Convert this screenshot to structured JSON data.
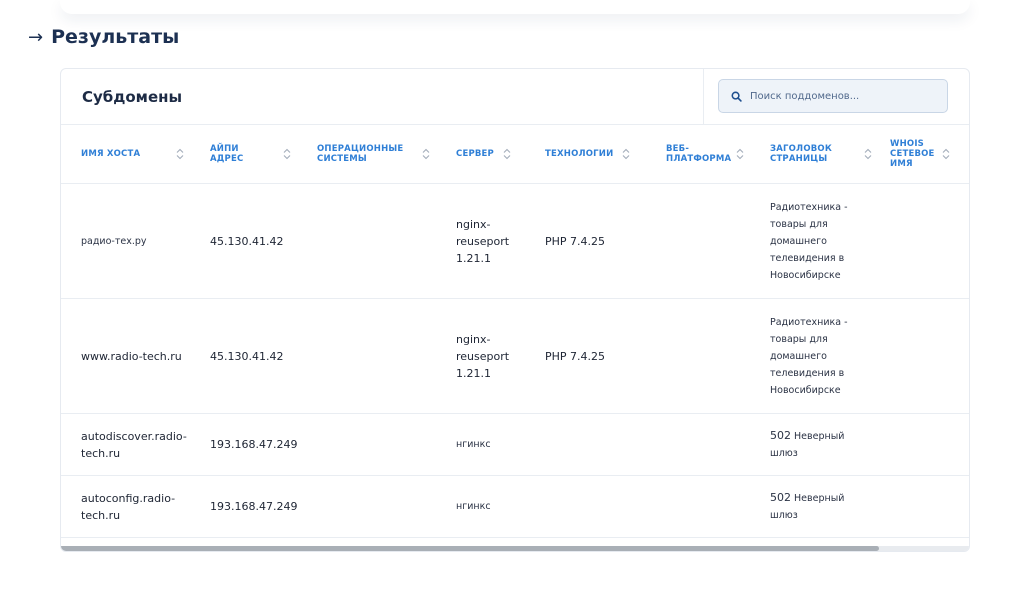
{
  "section": {
    "title": "Результаты"
  },
  "card": {
    "title": "Субдомены",
    "search_placeholder": "Поиск поддоменов..."
  },
  "table": {
    "columns": [
      {
        "label": "ИМЯ ХОСТА"
      },
      {
        "label": "АЙПИ АДРЕС"
      },
      {
        "label": "ОПЕРАЦИОННЫЕ СИСТЕМЫ"
      },
      {
        "label": "СЕРВЕР"
      },
      {
        "label": "ТЕХНОЛОГИИ"
      },
      {
        "label": "ВЕБ- ПЛАТФОРМА"
      },
      {
        "label": "ЗАГОЛОВОК СТРАНИЦЫ"
      },
      {
        "label": "WHOIS СЕТЕВОЕ ИМЯ"
      }
    ],
    "rows": [
      {
        "hostname": "радио-тех.ру",
        "ip": "45.130.41.42",
        "os": "",
        "server": "nginx-reuseport 1.21.1",
        "tech": "PHP 7.4.25",
        "platform": "",
        "page_title": "Радиотехника - товары для домашнего телевидения в Новосибирске",
        "whois": ""
      },
      {
        "hostname": "www.radio-tech.ru",
        "ip": "45.130.41.42",
        "os": "",
        "server": "nginx-reuseport 1.21.1",
        "tech": "PHP 7.4.25",
        "platform": "",
        "page_title": "Радиотехника - товары для домашнего телевидения в Новосибирске",
        "whois": ""
      },
      {
        "hostname": "autodiscover.radio-tech.ru",
        "ip": "193.168.47.249",
        "os": "",
        "server": "нгинкс",
        "tech": "",
        "platform": "",
        "page_title_code": "502",
        "page_title": "Неверный шлюз",
        "whois": ""
      },
      {
        "hostname": "autoconfig.radio-tech.ru",
        "ip": "193.168.47.249",
        "os": "",
        "server": "нгинкс",
        "tech": "",
        "platform": "",
        "page_title_code": "502",
        "page_title": "Неверный шлюз",
        "whois": ""
      }
    ]
  },
  "colors": {
    "accent": "#2f7fd6",
    "heading": "#1c3052"
  },
  "icons": {
    "heading": "arrow-right-icon",
    "search": "search-icon",
    "sort": "sort-chevrons-icon"
  }
}
